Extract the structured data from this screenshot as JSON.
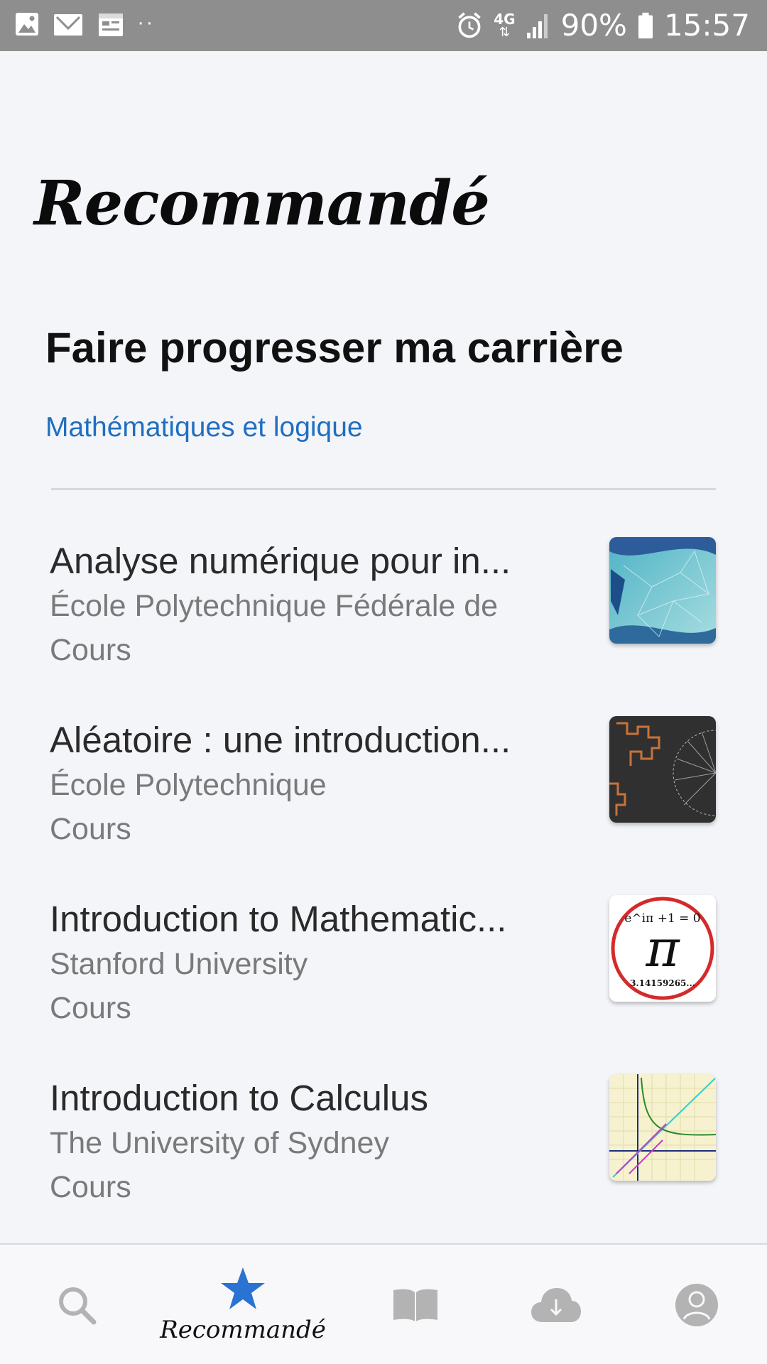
{
  "status_bar": {
    "network": "4G",
    "battery": "90%",
    "time": "15:57",
    "left_icons": [
      "image-icon",
      "mail-icon",
      "calendar-icon",
      "more-dots-icon"
    ],
    "right_icons": [
      "alarm-icon",
      "network-4g-icon",
      "signal-icon",
      "battery-icon"
    ]
  },
  "page": {
    "title": "Recommandé"
  },
  "section": {
    "title": "Faire progresser ma carrière",
    "category": "Mathématiques et logique"
  },
  "courses": [
    {
      "title": "Analyse numérique pour in...",
      "school": "École Polytechnique Fédérale de",
      "type": "Cours",
      "thumbnail": "mesh-thumbnail"
    },
    {
      "title": "Aléatoire : une introduction...",
      "school": "École Polytechnique",
      "type": "Cours",
      "thumbnail": "random-walk-thumbnail"
    },
    {
      "title": "Introduction to Mathematic...",
      "school": "Stanford University",
      "type": "Cours",
      "thumbnail": "pi-thumbnail",
      "thumbnail_text": {
        "formula": "e^iπ +1 = 0",
        "symbol": "π",
        "digits": "3.14159265..."
      }
    },
    {
      "title": "Introduction to Calculus",
      "school": "The University of Sydney",
      "type": "Cours",
      "thumbnail": "graph-thumbnail"
    }
  ],
  "bottom_nav": {
    "items": [
      {
        "icon": "search-icon",
        "label": "",
        "active": false
      },
      {
        "icon": "star-icon",
        "label": "Recommandé",
        "active": true
      },
      {
        "icon": "book-icon",
        "label": "",
        "active": false
      },
      {
        "icon": "download-cloud-icon",
        "label": "",
        "active": false
      },
      {
        "icon": "profile-icon",
        "label": "",
        "active": false
      }
    ]
  },
  "colors": {
    "accent": "#1f6fc0",
    "status_bar": "#8e8e8e",
    "background": "#f4f5f9",
    "inactive_icon": "#b3b3b3",
    "active_icon": "#2b73d2"
  }
}
